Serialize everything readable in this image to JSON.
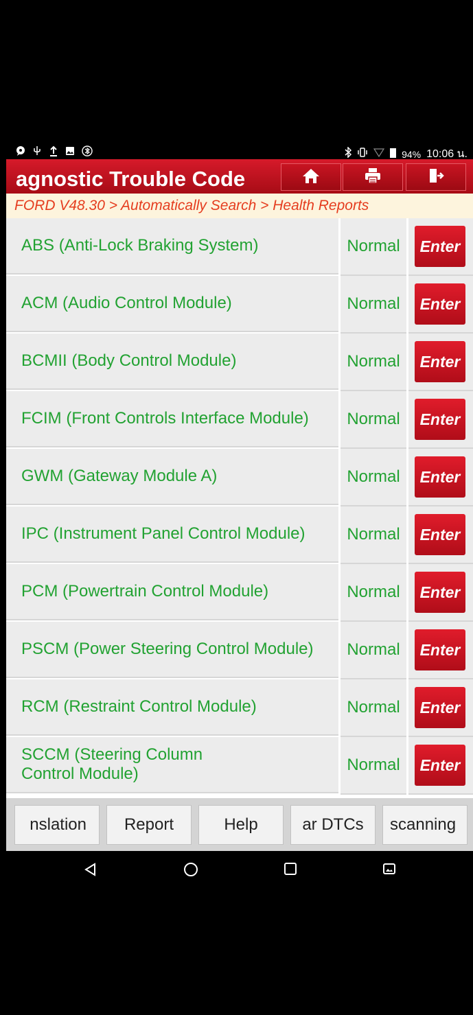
{
  "status": {
    "battery": "94%",
    "time": "10:06 น."
  },
  "header": {
    "title": "agnostic Trouble Code"
  },
  "breadcrumb": "FORD V48.30 > Automatically Search > Health Reports",
  "rows": [
    {
      "name": "ABS (Anti-Lock Braking System)",
      "status": "Normal",
      "button": "Enter"
    },
    {
      "name": "ACM (Audio Control Module)",
      "status": "Normal",
      "button": "Enter"
    },
    {
      "name": "BCMII (Body Control Module)",
      "status": "Normal",
      "button": "Enter"
    },
    {
      "name": "FCIM (Front Controls Interface Module)",
      "status": "Normal",
      "button": "Enter"
    },
    {
      "name": "GWM (Gateway Module A)",
      "status": "Normal",
      "button": "Enter"
    },
    {
      "name": "IPC (Instrument Panel Control Module)",
      "status": "Normal",
      "button": "Enter"
    },
    {
      "name": "PCM (Powertrain Control Module)",
      "status": "Normal",
      "button": "Enter"
    },
    {
      "name": "PSCM (Power Steering Control Module)",
      "status": "Normal",
      "button": "Enter"
    },
    {
      "name": "RCM (Restraint Control Module)",
      "status": "Normal",
      "button": "Enter"
    },
    {
      "name": "SCCM (Steering Column Control Module)",
      "status": "Normal",
      "button": "Enter"
    }
  ],
  "bottom_buttons": [
    "nslation",
    "Report",
    "Help",
    "ar DTCs",
    "scanning"
  ],
  "colors": {
    "header_red": "#c8121f",
    "text_green": "#22a232",
    "breadcrumb_orange": "#e53d1f"
  }
}
